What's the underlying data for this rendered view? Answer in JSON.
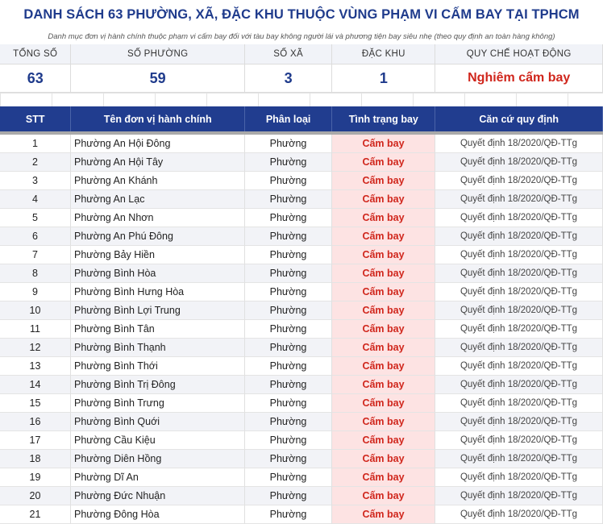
{
  "title": "DANH SÁCH 63 PHƯỜNG, XÃ, ĐẶC KHU THUỘC VÙNG PHẠM VI CẤM BAY TẠI TPHCM",
  "subtitle": "Danh mục đơn vị hành chính thuộc phạm vi cấm bay đối với tàu bay không người lái và phương tiện bay siêu nhẹ (theo quy định an toàn hàng không)",
  "summary": {
    "total_label": "TỔNG SỐ",
    "total_value": "63",
    "wards_label": "SỐ PHƯỜNG",
    "wards_value": "59",
    "communes_label": "SỐ XÃ",
    "communes_value": "3",
    "special_label": "ĐẶC KHU",
    "special_value": "1",
    "rule_label": "QUY CHẾ HOẠT ĐỘNG",
    "rule_value": "Nghiêm cấm bay"
  },
  "table": {
    "headers": {
      "stt": "STT",
      "name": "Tên đơn vị hành chính",
      "type": "Phân loại",
      "status": "Tình trạng bay",
      "basis": "Căn cứ quy định"
    },
    "rows": [
      {
        "stt": "1",
        "name": "Phường An Hội Đông",
        "type": "Phường",
        "status": "Cấm bay",
        "basis": "Quyết định 18/2020/QĐ-TTg"
      },
      {
        "stt": "2",
        "name": "Phường An Hội Tây",
        "type": "Phường",
        "status": "Cấm bay",
        "basis": "Quyết định 18/2020/QĐ-TTg"
      },
      {
        "stt": "3",
        "name": "Phường An Khánh",
        "type": "Phường",
        "status": "Cấm bay",
        "basis": "Quyết định 18/2020/QĐ-TTg"
      },
      {
        "stt": "4",
        "name": "Phường An Lạc",
        "type": "Phường",
        "status": "Cấm bay",
        "basis": "Quyết định 18/2020/QĐ-TTg"
      },
      {
        "stt": "5",
        "name": "Phường An Nhơn",
        "type": "Phường",
        "status": "Cấm bay",
        "basis": "Quyết định 18/2020/QĐ-TTg"
      },
      {
        "stt": "6",
        "name": "Phường An Phú Đông",
        "type": "Phường",
        "status": "Cấm bay",
        "basis": "Quyết định 18/2020/QĐ-TTg"
      },
      {
        "stt": "7",
        "name": "Phường Bảy Hiền",
        "type": "Phường",
        "status": "Cấm bay",
        "basis": "Quyết định 18/2020/QĐ-TTg"
      },
      {
        "stt": "8",
        "name": "Phường Bình Hòa",
        "type": "Phường",
        "status": "Cấm bay",
        "basis": "Quyết định 18/2020/QĐ-TTg"
      },
      {
        "stt": "9",
        "name": "Phường Bình Hưng Hòa",
        "type": "Phường",
        "status": "Cấm bay",
        "basis": "Quyết định 18/2020/QĐ-TTg"
      },
      {
        "stt": "10",
        "name": "Phường Bình Lợi Trung",
        "type": "Phường",
        "status": "Cấm bay",
        "basis": "Quyết định 18/2020/QĐ-TTg"
      },
      {
        "stt": "11",
        "name": "Phường Bình Tân",
        "type": "Phường",
        "status": "Cấm bay",
        "basis": "Quyết định 18/2020/QĐ-TTg"
      },
      {
        "stt": "12",
        "name": "Phường Bình Thạnh",
        "type": "Phường",
        "status": "Cấm bay",
        "basis": "Quyết định 18/2020/QĐ-TTg"
      },
      {
        "stt": "13",
        "name": "Phường Bình Thới",
        "type": "Phường",
        "status": "Cấm bay",
        "basis": "Quyết định 18/2020/QĐ-TTg"
      },
      {
        "stt": "14",
        "name": "Phường Bình Trị Đông",
        "type": "Phường",
        "status": "Cấm bay",
        "basis": "Quyết định 18/2020/QĐ-TTg"
      },
      {
        "stt": "15",
        "name": "Phường Bình Trưng",
        "type": "Phường",
        "status": "Cấm bay",
        "basis": "Quyết định 18/2020/QĐ-TTg"
      },
      {
        "stt": "16",
        "name": "Phường Bình Quới",
        "type": "Phường",
        "status": "Cấm bay",
        "basis": "Quyết định 18/2020/QĐ-TTg"
      },
      {
        "stt": "17",
        "name": "Phường Cầu Kiệu",
        "type": "Phường",
        "status": "Cấm bay",
        "basis": "Quyết định 18/2020/QĐ-TTg"
      },
      {
        "stt": "18",
        "name": "Phường Diên Hồng",
        "type": "Phường",
        "status": "Cấm bay",
        "basis": "Quyết định 18/2020/QĐ-TTg"
      },
      {
        "stt": "19",
        "name": "Phường Dĩ An",
        "type": "Phường",
        "status": "Cấm bay",
        "basis": "Quyết định 18/2020/QĐ-TTg"
      },
      {
        "stt": "20",
        "name": "Phường Đức Nhuận",
        "type": "Phường",
        "status": "Cấm bay",
        "basis": "Quyết định 18/2020/QĐ-TTg"
      },
      {
        "stt": "21",
        "name": "Phường Đông Hòa",
        "type": "Phường",
        "status": "Cấm bay",
        "basis": "Quyết định 18/2020/QĐ-TTg"
      }
    ]
  },
  "colors": {
    "header_bg": "#213d8f",
    "title": "#1f3b8c",
    "accent_red": "#d0261c",
    "status_bg": "#fde3e3"
  }
}
